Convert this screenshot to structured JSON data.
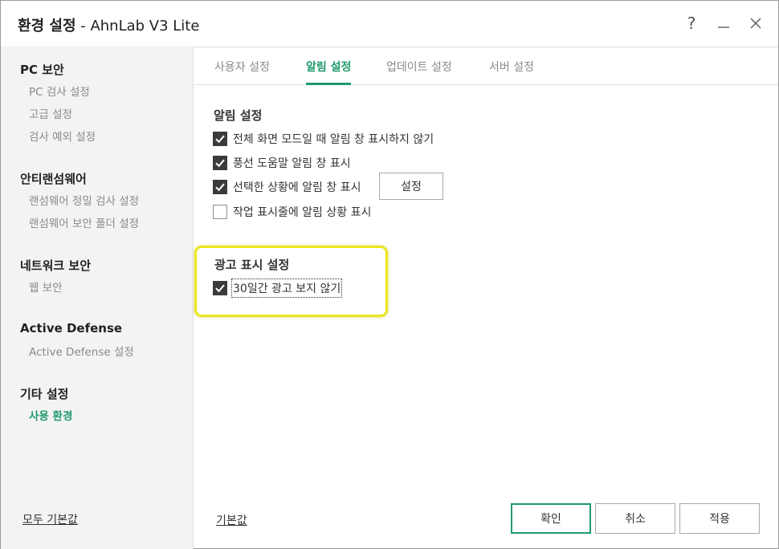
{
  "window": {
    "title_bold": "환경 설정",
    "title_rest": " - AhnLab V3 Lite",
    "help_glyph": "?",
    "minimize_glyph": "__",
    "close_glyph": "✕"
  },
  "sidebar": {
    "groups": [
      {
        "label": "PC 보안",
        "items": [
          {
            "label": "PC 검사 설정"
          },
          {
            "label": "고급 설정"
          },
          {
            "label": "검사 예외 설정"
          }
        ]
      },
      {
        "label": "안티랜섬웨어",
        "items": [
          {
            "label": "랜섬웨어 정밀 검사 설정"
          },
          {
            "label": "랜섬웨어 보안 폴더 설정"
          }
        ]
      },
      {
        "label": "네트워크 보안",
        "items": [
          {
            "label": "웹 보안"
          }
        ]
      },
      {
        "label": "Active Defense",
        "items": [
          {
            "label": "Active Defense 설정"
          }
        ]
      },
      {
        "label": "기타 설정",
        "items": [
          {
            "label": "사용 환경",
            "active": true
          }
        ]
      }
    ],
    "reset_all": "모두 기본값"
  },
  "tabs": [
    {
      "label": "사용자 설정",
      "active": false
    },
    {
      "label": "알림 설정",
      "active": true
    },
    {
      "label": "업데이트 설정",
      "active": false
    },
    {
      "label": "서버 설정",
      "active": false
    }
  ],
  "notification": {
    "title": "알림 설정",
    "options": [
      {
        "label": "전체 화면 모드일 때 알림 창 표시하지 않기",
        "checked": true
      },
      {
        "label": "풍선 도움말 알림 창 표시",
        "checked": true
      },
      {
        "label": "선택한 상황에 알림 창 표시",
        "checked": true
      },
      {
        "label": "작업 표시줄에 알림 상황 표시",
        "checked": false
      }
    ],
    "setting_button": "설정"
  },
  "ads": {
    "title": "광고 표시 설정",
    "option": {
      "label": "30일간 광고 보지 않기",
      "checked": true
    },
    "highlight_color": "#e9e61c"
  },
  "footer": {
    "reset": "기본값",
    "ok": "확인",
    "cancel": "취소",
    "apply": "적용"
  },
  "colors": {
    "accent": "#1f9a6b",
    "checkbox_fill": "#3b3b3b"
  }
}
